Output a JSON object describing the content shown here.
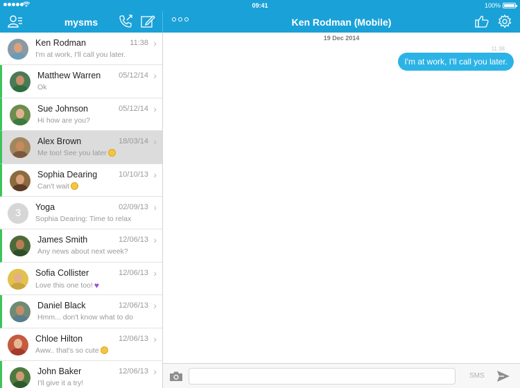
{
  "status_bar": {
    "time": "09:41",
    "battery": "100%"
  },
  "header": {
    "app_title": "mysms",
    "conversation_title": "Ken Rodman (Mobile)",
    "icons": [
      "contacts-icon",
      "call-icon",
      "compose-icon",
      "more-icon",
      "thumbs-up-icon",
      "gear-icon"
    ]
  },
  "conversations": [
    {
      "name": "Ken Rodman",
      "date": "11:38",
      "preview": "I'm at work, I'll call you later.",
      "emoji": "",
      "unread": false,
      "selected": false,
      "avatar": {
        "skin": "#d9a27c",
        "shirt": "#6a9bb8",
        "bg": "#8a9aa5"
      }
    },
    {
      "name": "Matthew Warren",
      "date": "05/12/14",
      "preview": "Ok",
      "emoji": "",
      "unread": true,
      "selected": false,
      "avatar": {
        "skin": "#c98f6b",
        "shirt": "#2d6e3c",
        "bg": "#4a7a56"
      }
    },
    {
      "name": "Sue Johnson",
      "date": "05/12/14",
      "preview": "Hi how are you?",
      "emoji": "",
      "unread": true,
      "selected": false,
      "avatar": {
        "skin": "#e2b08e",
        "shirt": "#3c7a3e",
        "bg": "#6b8e4e"
      }
    },
    {
      "name": "Alex Brown",
      "date": "18/03/14",
      "preview": "Me too! See you later",
      "emoji": "smile",
      "unread": true,
      "selected": true,
      "avatar": {
        "skin": "#c68a5e",
        "shirt": "#7b5a3c",
        "bg": "#a2875e"
      }
    },
    {
      "name": "Sophia Dearing",
      "date": "10/10/13",
      "preview": "Can't wait",
      "emoji": "smile",
      "unread": true,
      "selected": false,
      "avatar": {
        "skin": "#d8a07a",
        "shirt": "#5a3b25",
        "bg": "#8b6a40"
      }
    },
    {
      "name": "Yoga",
      "date": "02/09/13",
      "preview": "Sophia Dearing: Time to relax",
      "emoji": "",
      "unread": false,
      "selected": false,
      "group_count": "3"
    },
    {
      "name": "James Smith",
      "date": "12/06/13",
      "preview": "Any news about next week?",
      "emoji": "",
      "unread": true,
      "selected": false,
      "avatar": {
        "skin": "#b97d55",
        "shirt": "#2f4f2a",
        "bg": "#4d6b3a"
      }
    },
    {
      "name": "Sofia Collister",
      "date": "12/06/13",
      "preview": "Love this one too!",
      "emoji": "heart",
      "unread": false,
      "selected": false,
      "avatar": {
        "skin": "#e4b08a",
        "shirt": "#c9a63d",
        "bg": "#e2c14e"
      }
    },
    {
      "name": "Daniel Black",
      "date": "12/06/13",
      "preview": "Hmm... don't know what to do",
      "emoji": "",
      "unread": true,
      "selected": false,
      "avatar": {
        "skin": "#c58d66",
        "shirt": "#5b7d8e",
        "bg": "#6f8a75"
      }
    },
    {
      "name": "Chloe Hilton",
      "date": "12/06/13",
      "preview": "Aww.. that's so cute",
      "emoji": "smile",
      "unread": false,
      "selected": false,
      "avatar": {
        "skin": "#e7b794",
        "shirt": "#a33a2c",
        "bg": "#c45a3e"
      }
    },
    {
      "name": "John Baker",
      "date": "12/06/13",
      "preview": "I'll give it a try!",
      "emoji": "",
      "unread": true,
      "selected": false,
      "avatar": {
        "skin": "#cf9a74",
        "shirt": "#2a5a2e",
        "bg": "#4e7a3f"
      }
    }
  ],
  "chat": {
    "date_separator": "19 Dec 2014",
    "messages": [
      {
        "time": "11:38",
        "text": "I'm at work, I'll call you later.",
        "outgoing": true
      }
    ]
  },
  "composer": {
    "input_value": "",
    "placeholder": "",
    "channel_label": "SMS"
  },
  "colors": {
    "accent": "#1aa1d8",
    "bubble": "#2bb3e6",
    "unread_marker": "#3cc45a",
    "selected_row": "#dcdcdc"
  }
}
